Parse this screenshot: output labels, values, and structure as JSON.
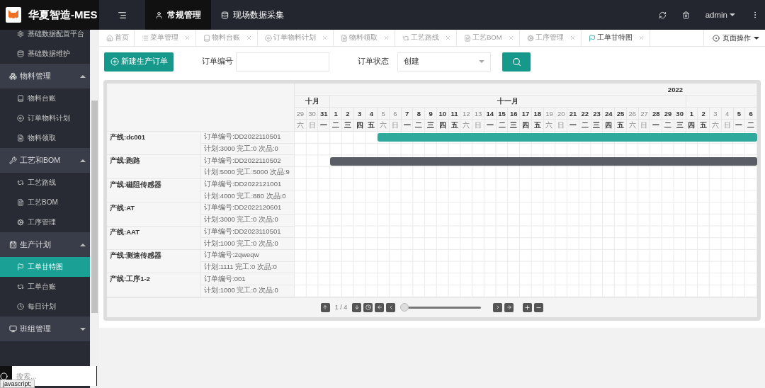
{
  "topbar": {
    "title": "华夏智造-MES",
    "nav": [
      {
        "label": "常规管理",
        "selected": true
      },
      {
        "label": "现场数据采集",
        "selected": false
      }
    ],
    "user": "admin"
  },
  "sidebar": {
    "leading_items": [
      {
        "label": "基础数据配置平台"
      },
      {
        "label": "基础数据维护"
      }
    ],
    "groups": [
      {
        "label": "物料管理",
        "expanded": true,
        "children": [
          {
            "label": "物料台账",
            "selected": false
          },
          {
            "label": "订单物料计划",
            "selected": false
          },
          {
            "label": "物料领取",
            "selected": false
          }
        ]
      },
      {
        "label": "工艺和BOM",
        "expanded": true,
        "children": [
          {
            "label": "工艺路线",
            "selected": false
          },
          {
            "label": "工艺BOM",
            "selected": false
          },
          {
            "label": "工序管理",
            "selected": false
          }
        ]
      },
      {
        "label": "生产计划",
        "expanded": true,
        "children": [
          {
            "label": "工单甘特图",
            "selected": true
          },
          {
            "label": "工单台账",
            "selected": false
          },
          {
            "label": "每日计划",
            "selected": false
          }
        ]
      },
      {
        "label": "班组管理",
        "expanded": false
      }
    ],
    "search": {
      "placeholder": "搜索..."
    }
  },
  "status_text": "javascript;",
  "tabs": [
    {
      "label": "首页",
      "selected": false,
      "closable": false
    },
    {
      "label": "菜单管理",
      "selected": false,
      "closable": true
    },
    {
      "label": "物料台账",
      "selected": false,
      "closable": true
    },
    {
      "label": "订单物料计划",
      "selected": false,
      "closable": true
    },
    {
      "label": "物料领取",
      "selected": false,
      "closable": true
    },
    {
      "label": "工艺路线",
      "selected": false,
      "closable": true
    },
    {
      "label": "工艺BOM",
      "selected": false,
      "closable": true
    },
    {
      "label": "工序管理",
      "selected": false,
      "closable": true
    },
    {
      "label": "工单甘特图",
      "selected": true,
      "closable": true
    }
  ],
  "page_actions": "页面操作",
  "toolbar": {
    "new_button": "新建生产订单",
    "order_no_label": "订单编号",
    "status_label": "订单状态",
    "status_value": "创建"
  },
  "gantt": {
    "year": "2022",
    "months": [
      {
        "label": "十月",
        "days": [
          {
            "day": "29",
            "weekday": "六",
            "weekend": true
          },
          {
            "day": "30",
            "weekday": "日",
            "weekend": true
          },
          {
            "day": "31",
            "weekday": "一",
            "weekend": false
          }
        ]
      },
      {
        "label": "十一月",
        "days": [
          {
            "day": "1",
            "weekday": "二",
            "weekend": false
          },
          {
            "day": "2",
            "weekday": "三",
            "weekend": false
          },
          {
            "day": "3",
            "weekday": "四",
            "weekend": false
          },
          {
            "day": "4",
            "weekday": "五",
            "weekend": false
          },
          {
            "day": "5",
            "weekday": "六",
            "weekend": true
          },
          {
            "day": "6",
            "weekday": "日",
            "weekend": true
          },
          {
            "day": "7",
            "weekday": "一",
            "weekend": false
          },
          {
            "day": "8",
            "weekday": "二",
            "weekend": false
          },
          {
            "day": "9",
            "weekday": "三",
            "weekend": false
          },
          {
            "day": "10",
            "weekday": "四",
            "weekend": false
          },
          {
            "day": "11",
            "weekday": "五",
            "weekend": false
          },
          {
            "day": "12",
            "weekday": "六",
            "weekend": true
          },
          {
            "day": "13",
            "weekday": "日",
            "weekend": true
          },
          {
            "day": "14",
            "weekday": "一",
            "weekend": false
          },
          {
            "day": "15",
            "weekday": "二",
            "weekend": false
          },
          {
            "day": "16",
            "weekday": "三",
            "weekend": false
          },
          {
            "day": "17",
            "weekday": "四",
            "weekend": false
          },
          {
            "day": "18",
            "weekday": "五",
            "weekend": false
          },
          {
            "day": "19",
            "weekday": "六",
            "weekend": true
          },
          {
            "day": "20",
            "weekday": "日",
            "weekend": true
          },
          {
            "day": "21",
            "weekday": "一",
            "weekend": false
          },
          {
            "day": "22",
            "weekday": "二",
            "weekend": false
          },
          {
            "day": "23",
            "weekday": "三",
            "weekend": false
          },
          {
            "day": "24",
            "weekday": "四",
            "weekend": false
          },
          {
            "day": "25",
            "weekday": "五",
            "weekend": false
          },
          {
            "day": "26",
            "weekday": "六",
            "weekend": true
          },
          {
            "day": "27",
            "weekday": "日",
            "weekend": true
          },
          {
            "day": "28",
            "weekday": "一",
            "weekend": false
          },
          {
            "day": "29",
            "weekday": "二",
            "weekend": false
          },
          {
            "day": "30",
            "weekday": "三",
            "weekend": false
          }
        ]
      },
      {
        "days": [
          {
            "day": "1",
            "weekday": "四",
            "weekend": false
          },
          {
            "day": "2",
            "weekday": "五",
            "weekend": false
          },
          {
            "day": "3",
            "weekday": "六",
            "weekend": true
          },
          {
            "day": "4",
            "weekday": "日",
            "weekend": true
          },
          {
            "day": "5",
            "weekday": "一",
            "weekend": false
          },
          {
            "day": "6",
            "weekday": "二",
            "weekend": false
          }
        ]
      }
    ],
    "orders": [
      {
        "line": "产线:dc001",
        "order_no": "订单编号:DD2022110501",
        "stats": "计划:3000 完工:0 次品:0",
        "bar": {
          "level": 0.8205,
          "color": "#2fa99b"
        }
      },
      {
        "line": "产线:跑路",
        "order_no": "订单编号:DD2022110502",
        "stats": "计划:5000 完工:5000 次品:9",
        "bar": {
          "level": 0.9231,
          "color": "#5b5d66"
        }
      },
      {
        "line": "产线:磁阻传感器",
        "order_no": "订单编号:DD2022121001",
        "stats": "计划:4000 完工:880 次品:0"
      },
      {
        "line": "产线:AT",
        "order_no": "订单编号:DD2022120601",
        "stats": "计划:3000 完工:0 次品:0"
      },
      {
        "line": "产线:AAT",
        "order_no": "订单编号:DD2023110501",
        "stats": "计划:1000 完工:0 次品:0"
      },
      {
        "line": "产线:测速传感器",
        "order_no": "订单编号:2qweqw",
        "stats": "计划:1111 完工:0 次品:0"
      },
      {
        "line": "产线:工序1-2",
        "order_no": "订单编号:001",
        "stats": "计划:1000 完工:0 次品:0"
      }
    ],
    "page_indicator": "1 / 4",
    "zoom_slider": {
      "level": 0
    }
  }
}
